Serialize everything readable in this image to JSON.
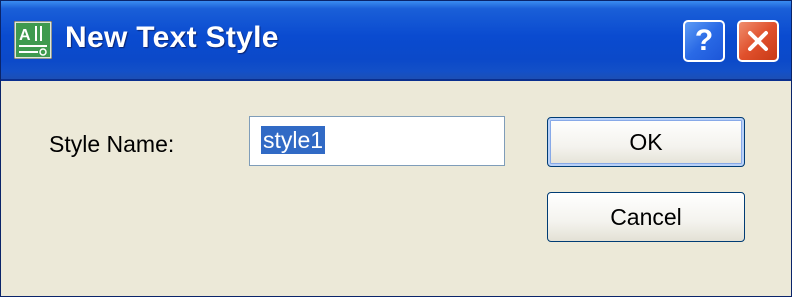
{
  "window": {
    "title": "New Text Style",
    "help_label": "?",
    "close_label": "close"
  },
  "form": {
    "style_name_label": "Style Name:",
    "style_name_value": "style1"
  },
  "buttons": {
    "ok_label": "OK",
    "cancel_label": "Cancel"
  },
  "icons": {
    "app": "text-style-icon",
    "help": "help-icon",
    "close": "close-icon"
  },
  "colors": {
    "titlebar": "#0a4bd0",
    "close_button": "#e0502c",
    "selection": "#316ac5",
    "dialog_background": "#ece9d8"
  }
}
